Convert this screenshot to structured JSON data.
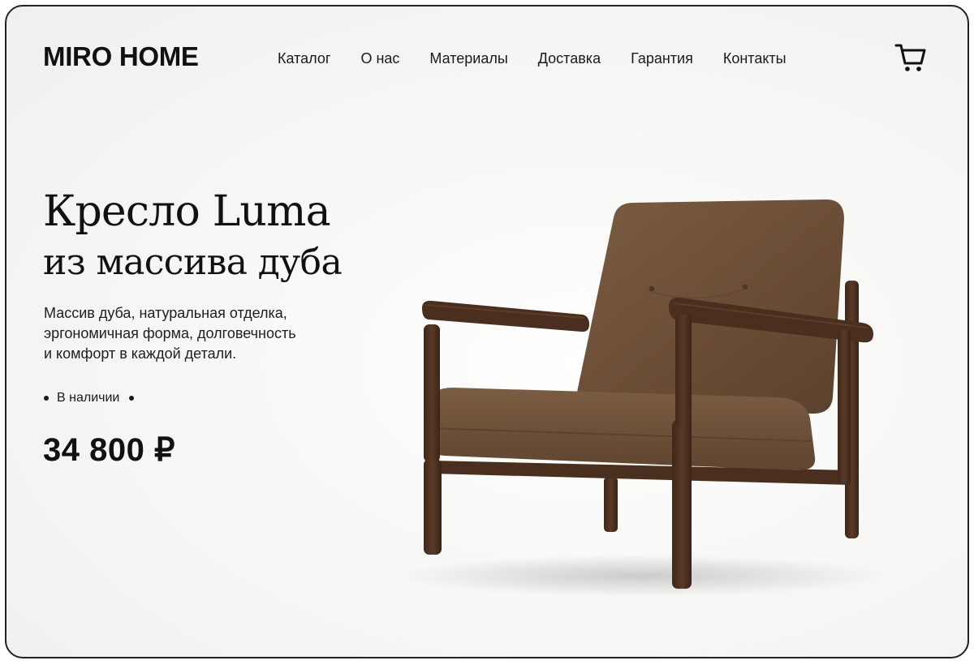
{
  "brand": {
    "logo_text": "MIRO HOME"
  },
  "nav": {
    "items": [
      {
        "label": "Каталог"
      },
      {
        "label": "О нас"
      },
      {
        "label": "Материалы"
      },
      {
        "label": "Доставка"
      },
      {
        "label": "Гарантия"
      },
      {
        "label": "Контакты"
      }
    ]
  },
  "header": {
    "cart_icon": "shopping-cart-icon"
  },
  "product": {
    "title_line1": "Кресло Luma",
    "title_line2": "из массива дуба",
    "description_lines": [
      "Массив дуба, натуральная отделка,",
      "эргономичная форма, долговечность",
      "и комфорт в каждой детали."
    ],
    "availability": "В наличии",
    "price": "34 800 ₽",
    "image": "armchair-photo"
  },
  "colors": {
    "text": "#111111",
    "upholstery": "#6b5038",
    "wood": "#4a2f1f",
    "background": "#f6f6f5"
  }
}
